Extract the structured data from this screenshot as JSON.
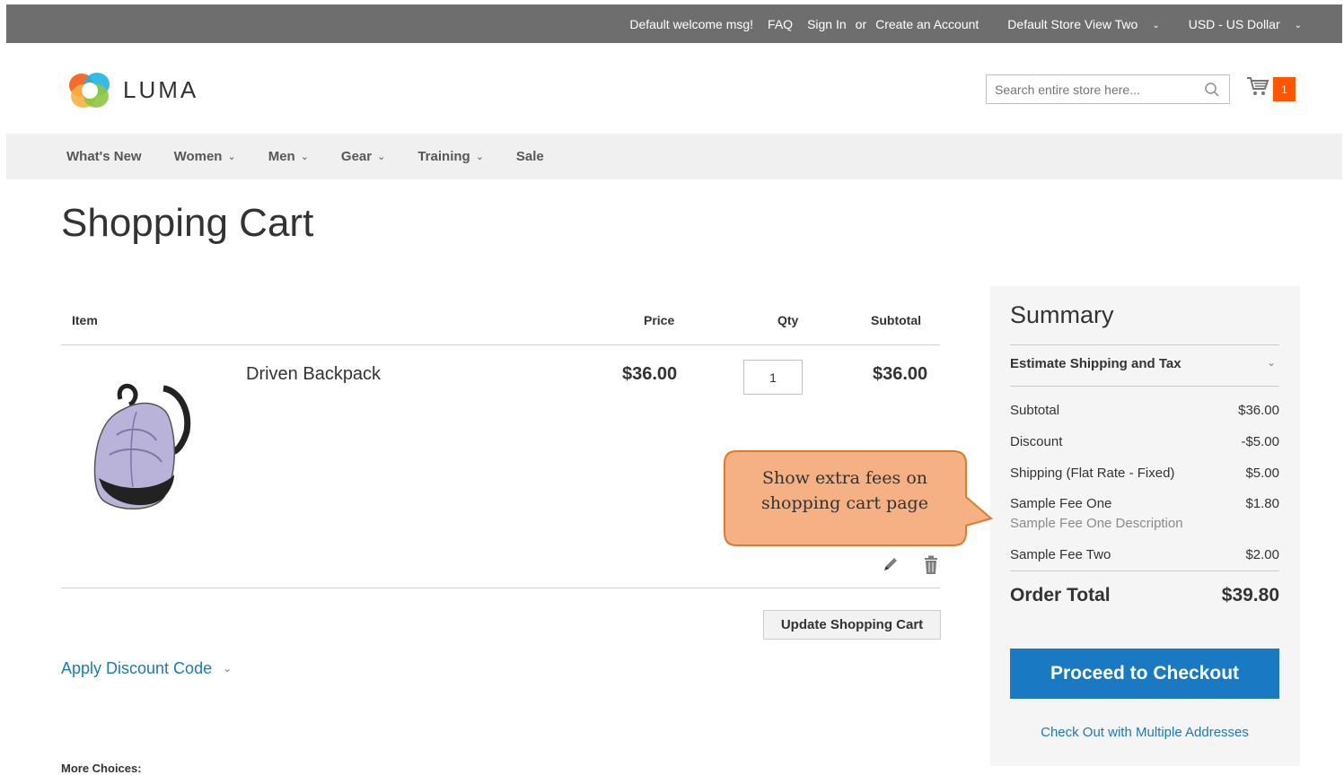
{
  "topbar": {
    "welcome": "Default welcome msg!",
    "faq": "FAQ",
    "sign_in": "Sign In",
    "or": "or",
    "create_account": "Create an Account",
    "store_view": "Default Store View Two",
    "currency": "USD - US Dollar"
  },
  "header": {
    "logo_text": "LUMA",
    "search_placeholder": "Search entire store here...",
    "cart_count": "1"
  },
  "nav": {
    "items": [
      {
        "label": "What's New",
        "has_dropdown": false
      },
      {
        "label": "Women",
        "has_dropdown": true
      },
      {
        "label": "Men",
        "has_dropdown": true
      },
      {
        "label": "Gear",
        "has_dropdown": true
      },
      {
        "label": "Training",
        "has_dropdown": true
      },
      {
        "label": "Sale",
        "has_dropdown": false
      }
    ]
  },
  "page": {
    "title": "Shopping Cart"
  },
  "cart": {
    "columns": {
      "item": "Item",
      "price": "Price",
      "qty": "Qty",
      "subtotal": "Subtotal"
    },
    "items": [
      {
        "name": "Driven Backpack",
        "price": "$36.00",
        "qty": "1",
        "subtotal": "$36.00"
      }
    ],
    "update_button": "Update Shopping Cart",
    "discount_link": "Apply Discount Code",
    "more_choices": "More Choices:"
  },
  "summary": {
    "title": "Summary",
    "estimate": "Estimate Shipping and Tax",
    "rows": [
      {
        "label": "Subtotal",
        "value": "$36.00"
      },
      {
        "label": "Discount",
        "value": "-$5.00"
      },
      {
        "label": "Shipping (Flat Rate - Fixed)",
        "value": "$5.00"
      },
      {
        "label": "Sample Fee One",
        "value": "$1.80",
        "description": "Sample Fee One Description"
      },
      {
        "label": "Sample Fee Two",
        "value": "$2.00"
      }
    ],
    "order_total_label": "Order Total",
    "order_total_value": "$39.80",
    "checkout_button": "Proceed to Checkout",
    "multi_address_link": "Check Out with Multiple Addresses"
  },
  "callout": {
    "line1": "Show extra fees on",
    "line2": "shopping cart page"
  },
  "colors": {
    "accent": "#1979c3",
    "cart_badge": "#ff5501",
    "callout_fill": "#f5b183",
    "callout_stroke": "#e07a2c"
  }
}
